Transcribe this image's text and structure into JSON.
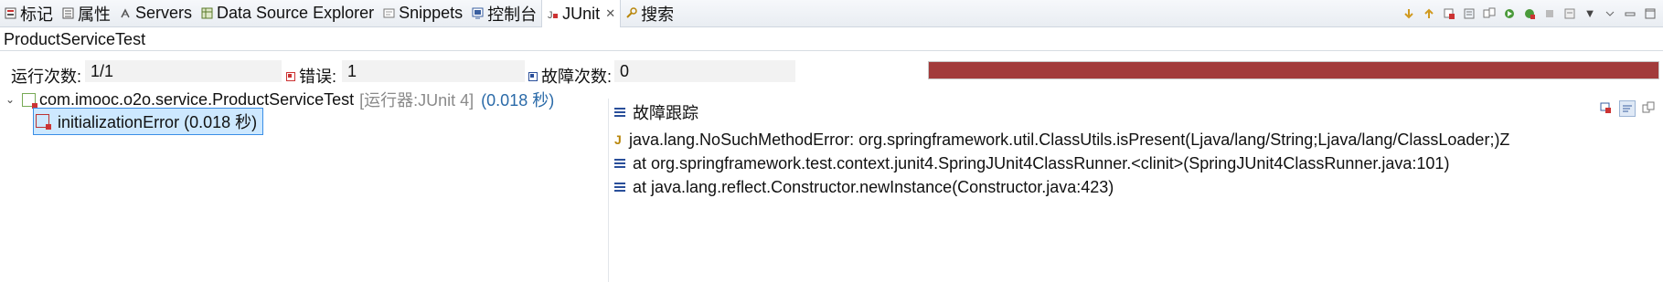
{
  "tabs": [
    {
      "label": "标记",
      "icon": "markers-icon"
    },
    {
      "label": "属性",
      "icon": "properties-icon"
    },
    {
      "label": "Servers",
      "icon": "servers-icon"
    },
    {
      "label": "Data Source Explorer",
      "icon": "data-source-icon"
    },
    {
      "label": "Snippets",
      "icon": "snippets-icon"
    },
    {
      "label": "控制台",
      "icon": "console-icon"
    },
    {
      "label": "JUnit",
      "icon": "junit-icon",
      "active": true
    },
    {
      "label": "搜索",
      "icon": "search-icon"
    }
  ],
  "view_title": "ProductServiceTest",
  "counters": {
    "runs_label": "运行次数:",
    "runs_value": "1/1",
    "errors_label": "错误:",
    "errors_value": "1",
    "failures_label": "故障次数:",
    "failures_value": "0"
  },
  "progress": {
    "fraction": 1.0,
    "color": "#a23b3b"
  },
  "tree": {
    "suite": {
      "name": "com.imooc.o2o.service.ProductServiceTest",
      "runner": "[运行器:JUnit 4]",
      "time": "(0.018 秒)"
    },
    "case": {
      "name": "initializationError",
      "time": "(0.018 秒)"
    }
  },
  "trace": {
    "header": "故障跟踪",
    "lines": [
      "java.lang.NoSuchMethodError: org.springframework.util.ClassUtils.isPresent(Ljava/lang/String;Ljava/lang/ClassLoader;)Z",
      "at org.springframework.test.context.junit4.SpringJUnit4ClassRunner.<clinit>(SpringJUnit4ClassRunner.java:101)",
      "at java.lang.reflect.Constructor.newInstance(Constructor.java:423)"
    ]
  }
}
